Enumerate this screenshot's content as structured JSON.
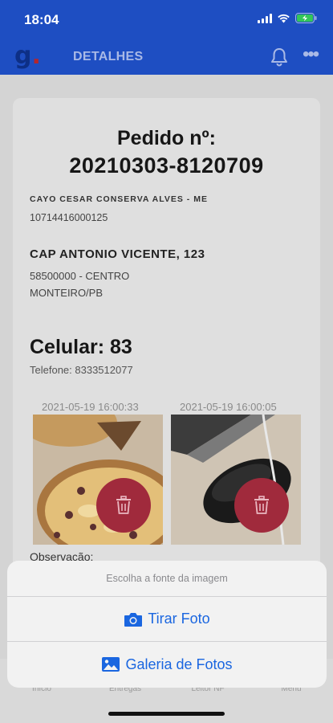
{
  "status_bar": {
    "time": "18:04"
  },
  "nav": {
    "logo_letter": "g",
    "logo_dot": ".",
    "title": "DETALHES",
    "more_label": "•••"
  },
  "order": {
    "label": "Pedido nº:",
    "number": "20210303-8120709",
    "company": "CAYO CESAR CONSERVA ALVES - ME",
    "cnpj": "10714416000125",
    "street": "CAP ANTONIO VICENTE, 123",
    "zip_district": "58500000 - CENTRO",
    "city": "MONTEIRO/PB",
    "celular": "Celular: 83",
    "telefone": "Telefone: 8333512077",
    "observacao_label": "Observação:"
  },
  "photos": [
    {
      "timestamp": "2021-05-19 16:00:33",
      "subject": "pizza"
    },
    {
      "timestamp": "2021-05-19 16:00:05",
      "subject": "mouse"
    }
  ],
  "tabs": [
    {
      "label": "Início"
    },
    {
      "label": "Entregas"
    },
    {
      "label": "Leitor NF"
    },
    {
      "label": "Menu"
    }
  ],
  "sheet": {
    "title": "Escolha a fonte da imagem",
    "take_photo": "Tirar Foto",
    "gallery": "Galeria de Fotos"
  },
  "colors": {
    "brand_blue": "#1e4ec2",
    "delete_red": "#a02a3c",
    "ios_blue": "#1a66e0"
  }
}
